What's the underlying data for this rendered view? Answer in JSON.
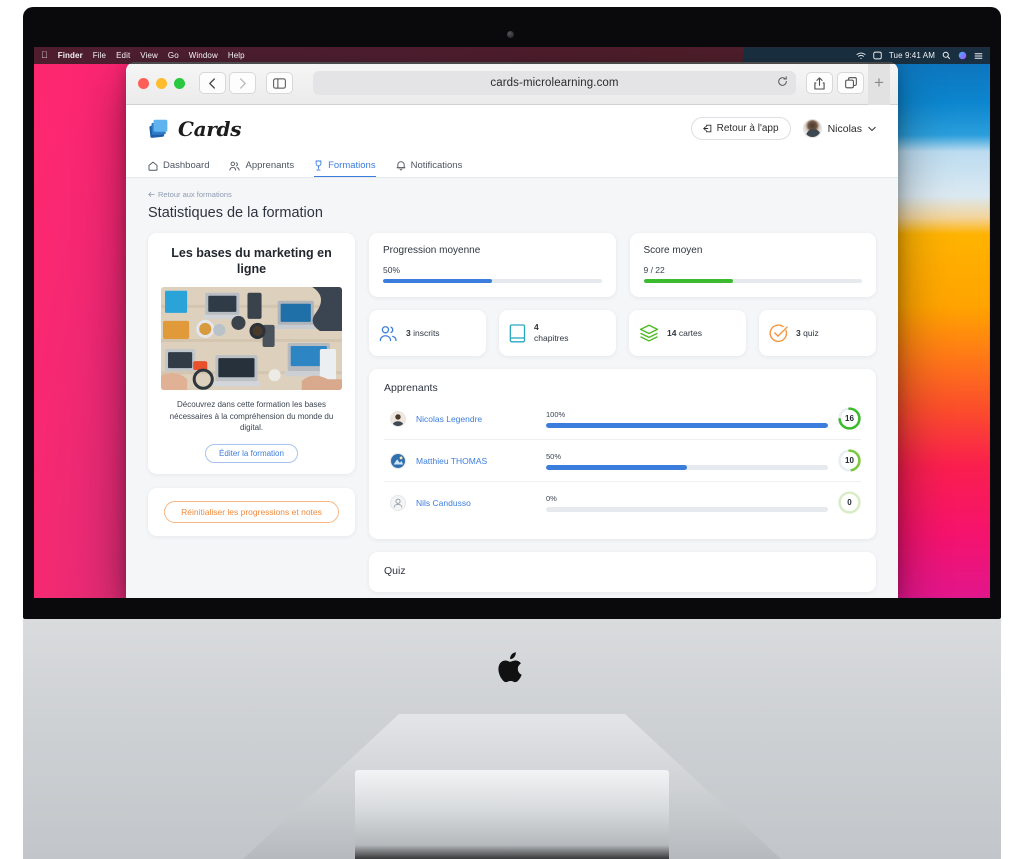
{
  "menubar": {
    "apple": "apple-logo",
    "items": [
      "Finder",
      "File",
      "Edit",
      "View",
      "Go",
      "Window",
      "Help"
    ],
    "clock": "Tue 9:41 AM"
  },
  "browser": {
    "url": "cards-microlearning.com",
    "newtab_label": "+",
    "buttons": {
      "back": "back-icon",
      "forward": "forward-icon",
      "sidebar": "sidebar-toggle-icon",
      "reload": "reload-icon",
      "share": "share-icon",
      "tabs": "tab-overview-icon"
    }
  },
  "app": {
    "logo_text": "Cards",
    "back_to_app": "Retour à l'app",
    "user_name": "Nicolas",
    "nav": [
      {
        "label": "Dashboard",
        "icon": "home-icon",
        "active": false
      },
      {
        "label": "Apprenants",
        "icon": "people-icon",
        "active": false
      },
      {
        "label": "Formations",
        "icon": "trophy-icon",
        "active": true
      },
      {
        "label": "Notifications",
        "icon": "bell-icon",
        "active": false
      }
    ]
  },
  "main": {
    "breadcrumb": "Retour aux formations",
    "title": "Statistiques de la formation",
    "course": {
      "title": "Les bases du marketing en ligne",
      "description": "Découvrez dans cette formation les bases nécessaires à la compréhension du monde du digital.",
      "edit_button": "Éditer la formation",
      "reset_button": "Réinitialiser les progressions et notes"
    },
    "stats": {
      "progress": {
        "label": "Progression moyenne",
        "value": "50%",
        "percent": 50,
        "color": "#3b7ddd"
      },
      "score": {
        "label": "Score moyen",
        "value": "9 / 22",
        "percent": 41,
        "color": "#3dbb2e"
      }
    },
    "mini_stats": [
      {
        "number": "3",
        "unit": "inscrits",
        "icon": "people-icon",
        "color": "#3b7ddd",
        "stacked": false
      },
      {
        "number": "4",
        "unit": "chapitres",
        "icon": "book-icon",
        "color": "#2aa8bd",
        "stacked": true
      },
      {
        "number": "14",
        "unit": "cartes",
        "icon": "layers-icon",
        "color": "#4cba20",
        "stacked": false
      },
      {
        "number": "3",
        "unit": "quiz",
        "icon": "check-circle-icon",
        "color": "#f6943c",
        "stacked": false
      }
    ],
    "learners": {
      "title": "Apprenants",
      "rows": [
        {
          "name": "Nicolas Legendre",
          "percent_label": "100%",
          "percent": 100,
          "score": "16",
          "ring_percent": 73,
          "ring_color": "#3dbb2e",
          "avatar": "photo"
        },
        {
          "name": "Matthieu THOMAS",
          "percent_label": "50%",
          "percent": 50,
          "score": "10",
          "ring_percent": 46,
          "ring_color": "#7cc93f",
          "avatar": "photo"
        },
        {
          "name": "Nils Candusso",
          "percent_label": "0%",
          "percent": 0,
          "score": "0",
          "ring_percent": 0,
          "ring_color": "#a9d98a",
          "avatar": "placeholder"
        }
      ]
    },
    "quiz_section": {
      "title": "Quiz"
    }
  }
}
